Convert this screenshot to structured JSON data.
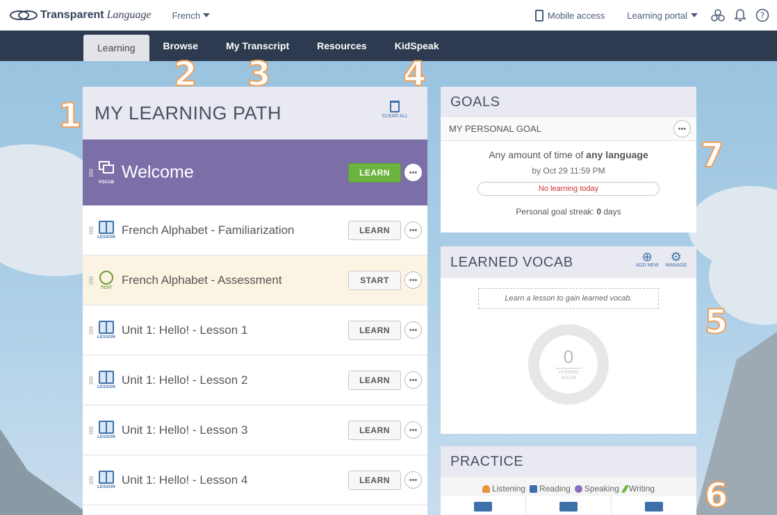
{
  "topbar": {
    "brand_bold": "Transparent",
    "brand_italic": "Language",
    "language": "French",
    "mobile_access": "Mobile access",
    "learning_portal": "Learning portal"
  },
  "nav": {
    "tabs": [
      {
        "label": "Learning"
      },
      {
        "label": "Browse"
      },
      {
        "label": "My Transcript"
      },
      {
        "label": "Resources"
      },
      {
        "label": "KidSpeak"
      }
    ]
  },
  "annotations": [
    "1",
    "2",
    "3",
    "4",
    "5",
    "6",
    "7"
  ],
  "learning_path": {
    "title": "MY LEARNING PATH",
    "clear_all": "CLEAR ALL",
    "welcome": {
      "title": "Welcome",
      "kind": "VOCAB",
      "button": "LEARN"
    },
    "items": [
      {
        "title": "French Alphabet - Familiarization",
        "kind": "LESSON",
        "button": "LEARN"
      },
      {
        "title": "French Alphabet - Assessment",
        "kind": "TEST",
        "button": "START"
      },
      {
        "title": "Unit 1: Hello! - Lesson 1",
        "kind": "LESSON",
        "button": "LEARN"
      },
      {
        "title": "Unit 1: Hello! - Lesson 2",
        "kind": "LESSON",
        "button": "LEARN"
      },
      {
        "title": "Unit 1: Hello! - Lesson 3",
        "kind": "LESSON",
        "button": "LEARN"
      },
      {
        "title": "Unit 1: Hello! - Lesson 4",
        "kind": "LESSON",
        "button": "LEARN"
      }
    ]
  },
  "goals": {
    "title": "GOALS",
    "sub": "MY PERSONAL GOAL",
    "text_prefix": "Any amount of time of ",
    "text_bold": "any language",
    "date": "by Oct 29 11:59 PM",
    "status": "No learning today",
    "streak_prefix": "Personal goal streak: ",
    "streak_value": "0",
    "streak_suffix": " days"
  },
  "vocab": {
    "title": "LEARNED VOCAB",
    "add_new": "ADD NEW",
    "manage": "MANAGE",
    "hint": "Learn a lesson to gain learned vocab.",
    "count": "0",
    "label_line1": "LEARNED",
    "label_line2": "VOCAB"
  },
  "practice": {
    "title": "PRACTICE",
    "skills": [
      {
        "label": "Listening",
        "color": "#e8943a"
      },
      {
        "label": "Reading",
        "color": "#3d6fa8"
      },
      {
        "label": "Speaking",
        "color": "#8a6fc0"
      },
      {
        "label": "Writing",
        "color": "#6db33f"
      }
    ]
  },
  "colors": {
    "nav_bg": "#2d3a4f",
    "welcome_bg": "#7c6fa8",
    "learn_green": "#6db33f",
    "annotation_orange": "#f0a15a",
    "link_blue": "#3d6fa8"
  }
}
